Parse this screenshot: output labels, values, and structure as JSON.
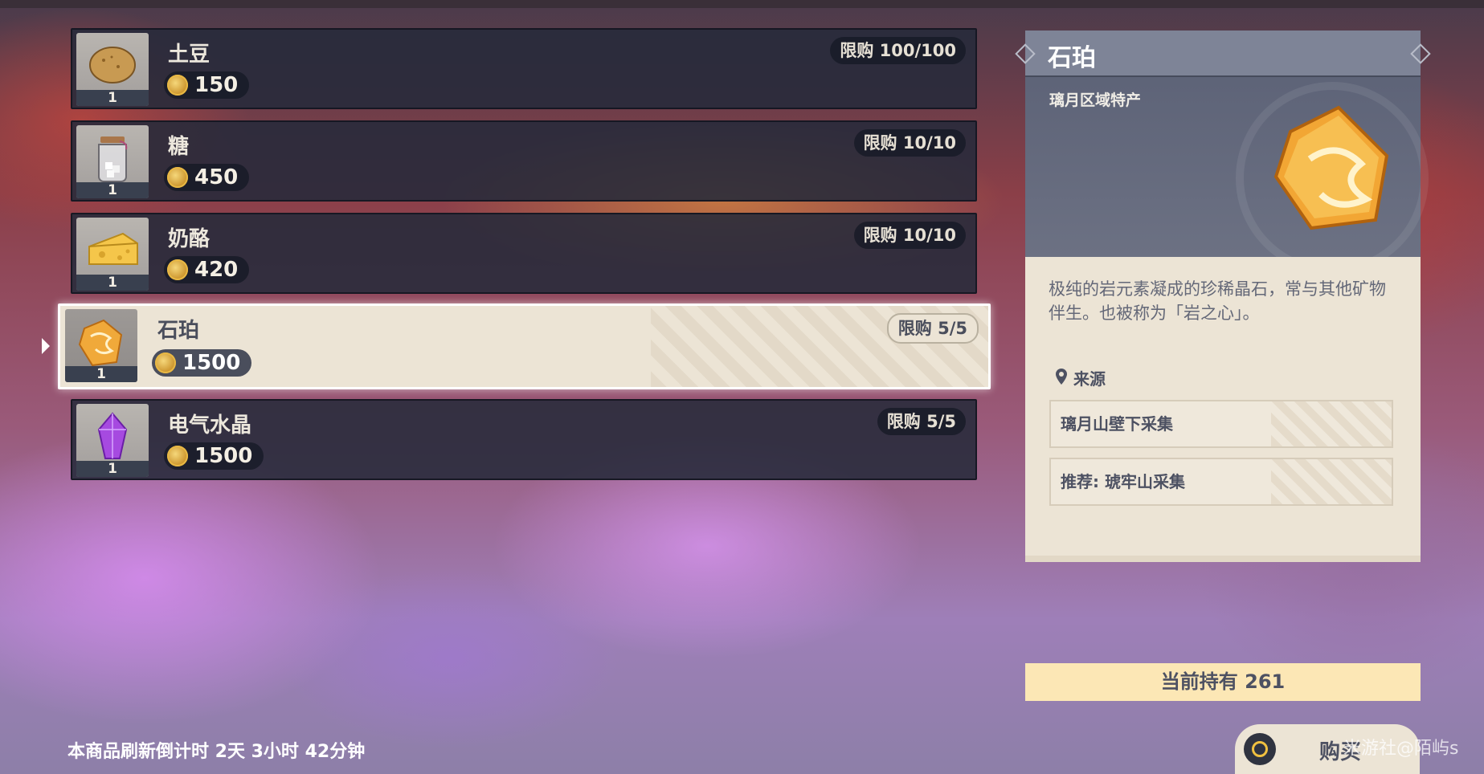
{
  "shop": {
    "items": [
      {
        "name": "土豆",
        "qty": "1",
        "price": "150",
        "limit": "限购 100/100",
        "icon": "potato-icon"
      },
      {
        "name": "糖",
        "qty": "1",
        "price": "450",
        "limit": "限购 10/10",
        "icon": "sugar-jar-icon"
      },
      {
        "name": "奶酪",
        "qty": "1",
        "price": "420",
        "limit": "限购 10/10",
        "icon": "cheese-icon"
      },
      {
        "name": "石珀",
        "qty": "1",
        "price": "1500",
        "limit": "限购 5/5",
        "icon": "amber-stone-icon",
        "selected": true
      },
      {
        "name": "电气水晶",
        "qty": "1",
        "price": "1500",
        "limit": "限购 5/5",
        "icon": "electro-crystal-icon"
      }
    ],
    "refresh_text": "本商品刷新倒计时 2天 3小时 42分钟"
  },
  "detail": {
    "title": "石珀",
    "subtitle": "璃月区域特产",
    "icon": "amber-stone-icon",
    "description": "极纯的岩元素凝成的珍稀晶石，常与其他矿物伴生。也被称为「岩之心」。",
    "source_label": "来源",
    "sources": [
      "璃月山壁下采集",
      "推荐: 琥牢山采集"
    ]
  },
  "owned_text": "当前持有 261",
  "buy_label": "购买",
  "watermark": "米游社@陌屿s",
  "colors": {
    "panel_dark": "#262a3a",
    "panel_light": "#ece4d5",
    "coin": "#e8b844",
    "owned_bg": "#fce7b5"
  }
}
